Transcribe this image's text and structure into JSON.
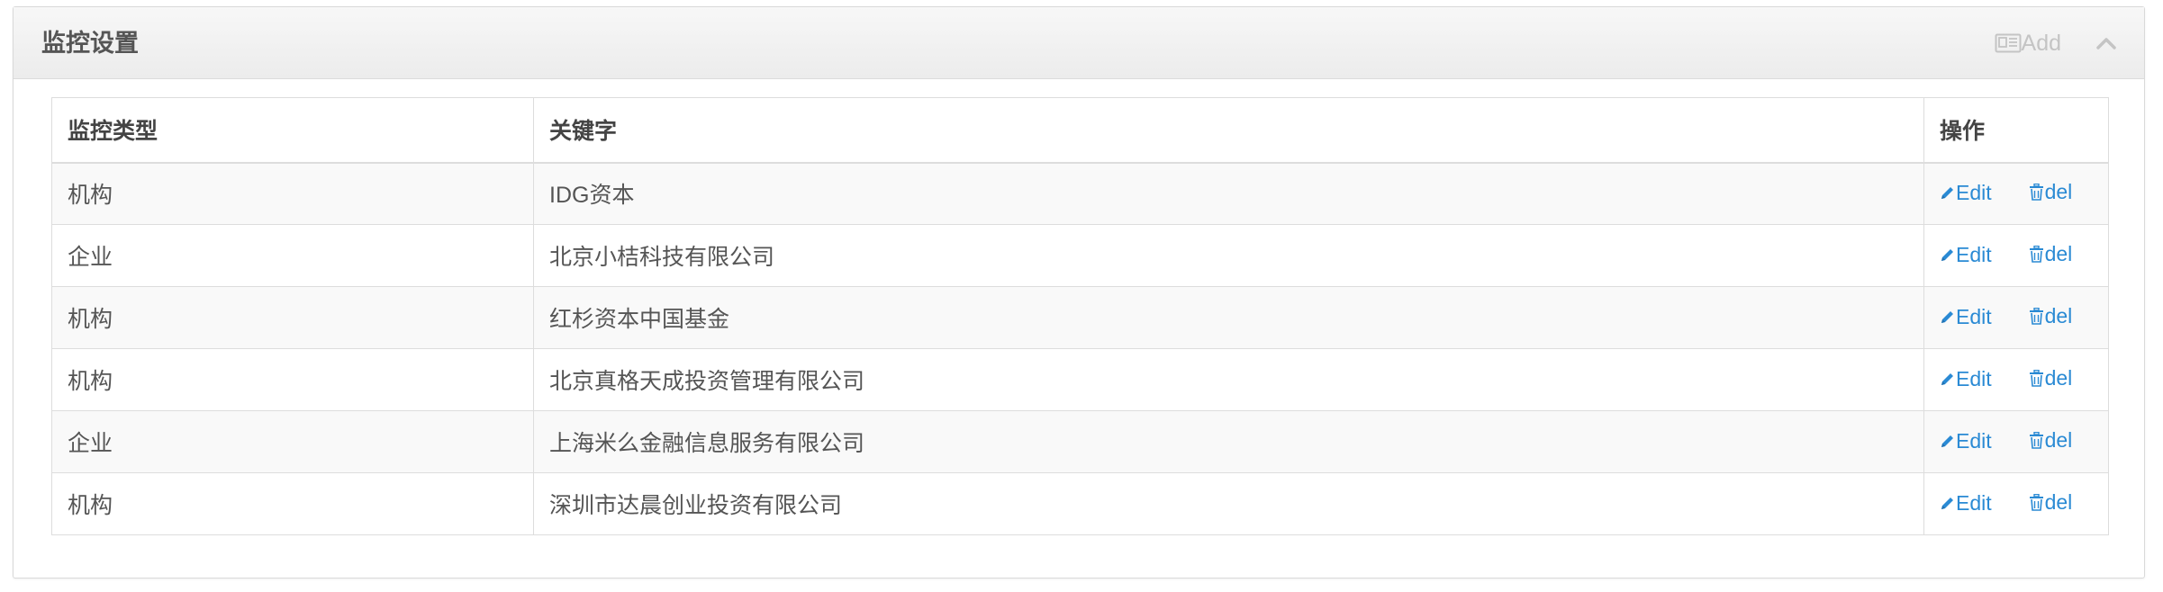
{
  "panel": {
    "title": "监控设置",
    "add_label": "Add",
    "add_icon": "id-card-icon",
    "collapse_icon": "chevron-up-icon"
  },
  "table": {
    "headers": [
      "监控类型",
      "关键字",
      "操作"
    ],
    "edit_label": "Edit",
    "del_label": "del",
    "edit_icon": "pencil-icon",
    "del_icon": "trash-icon",
    "rows": [
      {
        "type": "机构",
        "keyword": "IDG资本"
      },
      {
        "type": "企业",
        "keyword": "北京小桔科技有限公司"
      },
      {
        "type": "机构",
        "keyword": "红杉资本中国基金"
      },
      {
        "type": "机构",
        "keyword": "北京真格天成投资管理有限公司"
      },
      {
        "type": "企业",
        "keyword": "上海米么金融信息服务有限公司"
      },
      {
        "type": "机构",
        "keyword": "深圳市达晨创业投资有限公司"
      }
    ]
  },
  "colors": {
    "link": "#2a8ad4",
    "header_bg": "#efefef",
    "muted": "#c4c4c4"
  }
}
